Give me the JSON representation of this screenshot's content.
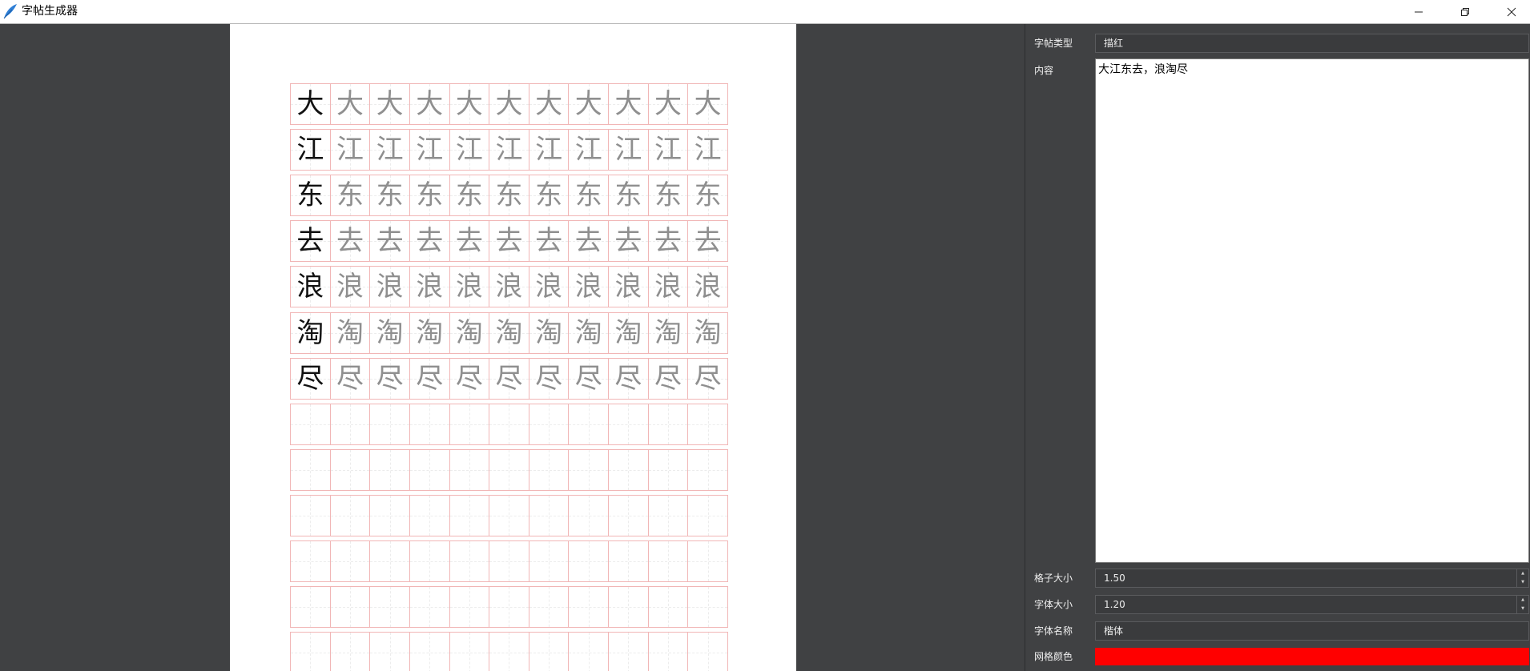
{
  "window": {
    "title": "字帖生成器",
    "controls": [
      "minimize",
      "restore",
      "close"
    ]
  },
  "preview": {
    "cell_colors": {
      "border": "#f1b6b6",
      "guide": "#ececec",
      "model_char": "#111111",
      "trace_char": "#8f8f8f"
    },
    "columns": 11,
    "filled_rows": [
      {
        "char": "大"
      },
      {
        "char": "江"
      },
      {
        "char": "东"
      },
      {
        "char": "去"
      },
      {
        "char": "浪"
      },
      {
        "char": "淘"
      },
      {
        "char": "尽"
      }
    ],
    "empty_rows": 6
  },
  "settings": {
    "type": {
      "label": "字帖类型",
      "value": "描红"
    },
    "content": {
      "label": "内容",
      "value": "大江东去，浪淘尽"
    },
    "cell_size": {
      "label": "格子大小",
      "value": "1.50"
    },
    "font_size": {
      "label": "字体大小",
      "value": "1.20"
    },
    "font_name": {
      "label": "字体名称",
      "value": "楷体"
    },
    "grid_color": {
      "label": "网格颜色",
      "value": "#ff0000"
    }
  }
}
